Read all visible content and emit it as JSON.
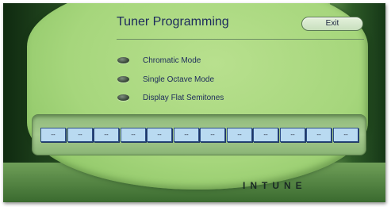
{
  "window": {
    "title": "Tuner Programming",
    "exit_label": "Exit"
  },
  "options": [
    {
      "label": "Chromatic Mode",
      "state": "off"
    },
    {
      "label": "Single Octave Mode",
      "state": "off"
    },
    {
      "label": "Display Flat Semitones",
      "state": "off"
    }
  ],
  "notes": [
    "--",
    "--",
    "--",
    "--",
    "--",
    "--",
    "--",
    "--",
    "--",
    "--",
    "--",
    "--"
  ],
  "brand": "INTUNE",
  "colors": {
    "panel_green": "#a6d67c",
    "dark_green": "#1f3f1c",
    "text_navy": "#1c2a5c",
    "note_box_fill": "#b9daf1",
    "note_box_border": "#2d4e86"
  }
}
